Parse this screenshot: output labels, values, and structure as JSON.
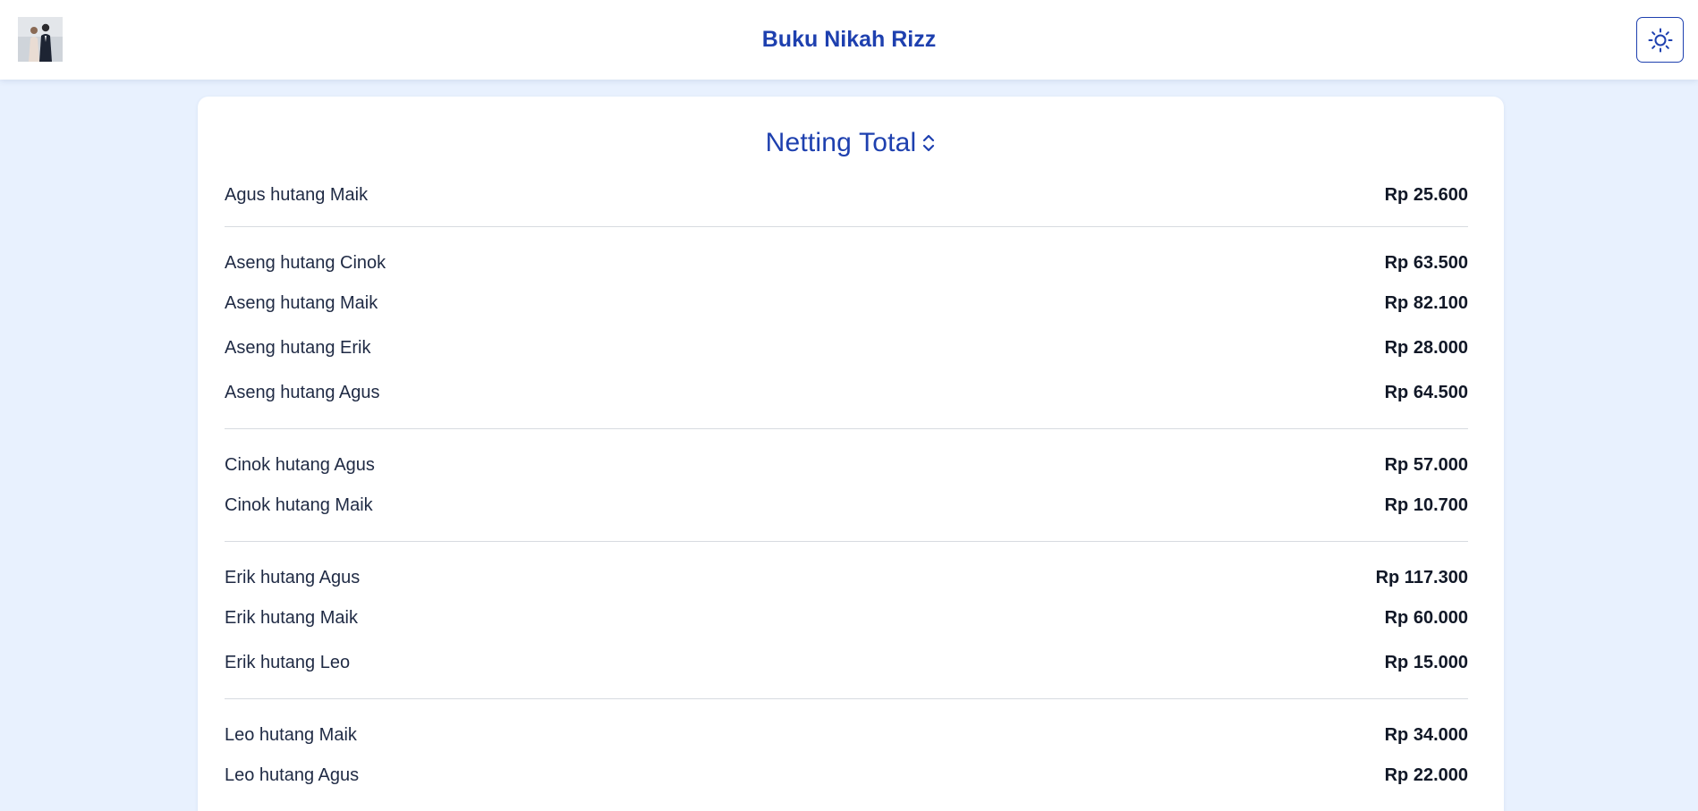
{
  "header": {
    "title": "Buku Nikah Rizz",
    "avatar_icon": "couple-photo-avatar",
    "theme_toggle_icon": "sun-icon"
  },
  "section": {
    "title": "Netting Total",
    "sort_icon": "chevron-up-down-icon"
  },
  "groups": [
    {
      "items": [
        {
          "label": "Agus hutang Maik",
          "amount": "Rp 25.600"
        }
      ]
    },
    {
      "items": [
        {
          "label": "Aseng hutang Cinok",
          "amount": "Rp 63.500"
        },
        {
          "label": "Aseng hutang Maik",
          "amount": "Rp 82.100"
        },
        {
          "label": "Aseng hutang Erik",
          "amount": "Rp 28.000"
        },
        {
          "label": "Aseng hutang Agus",
          "amount": "Rp 64.500"
        }
      ]
    },
    {
      "items": [
        {
          "label": "Cinok hutang Agus",
          "amount": "Rp 57.000"
        },
        {
          "label": "Cinok hutang Maik",
          "amount": "Rp 10.700"
        }
      ]
    },
    {
      "items": [
        {
          "label": "Erik hutang Agus",
          "amount": "Rp 117.300"
        },
        {
          "label": "Erik hutang Maik",
          "amount": "Rp 60.000"
        },
        {
          "label": "Erik hutang Leo",
          "amount": "Rp 15.000"
        }
      ]
    },
    {
      "items": [
        {
          "label": "Leo hutang Maik",
          "amount": "Rp 34.000"
        },
        {
          "label": "Leo hutang Agus",
          "amount": "Rp 22.000"
        }
      ]
    }
  ],
  "colors": {
    "accent": "#1e40af",
    "background": "#e8f1fe",
    "card": "#ffffff",
    "divider": "#d7dbe0"
  }
}
